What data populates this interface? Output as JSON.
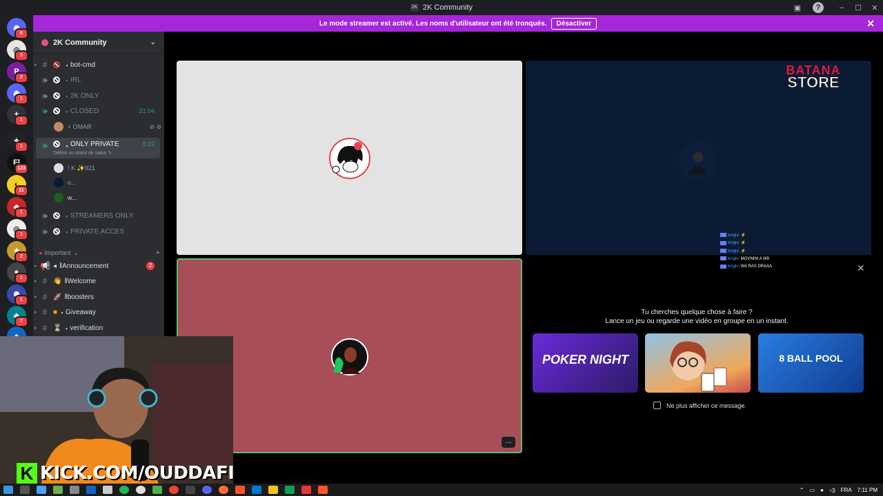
{
  "window": {
    "title": "2K Community",
    "title_icon": "2K",
    "min": "–",
    "max": "☐",
    "close": "✕",
    "help": "?",
    "inbox_icon": "▣"
  },
  "banner": {
    "text": "Le mode streamer est activé. Les noms d'utilisateur ont été tronqués.",
    "button": "Désactiver",
    "close": "✕"
  },
  "rail": {
    "servers": [
      {
        "icon": "discord-icon",
        "color": "#5865f2",
        "badge": "6",
        "glyph": "◉"
      },
      {
        "icon": "server-icon",
        "color": "#e6e6e6",
        "badge": "3",
        "glyph": "◎"
      },
      {
        "icon": "server-icon",
        "color": "#7b1fa2",
        "badge": "2",
        "glyph": "P"
      },
      {
        "icon": "server-icon",
        "color": "#5865f2",
        "badge": "1",
        "glyph": "◉"
      },
      {
        "icon": "add-icon",
        "color": "#313338",
        "badge": "1",
        "glyph": "+"
      },
      {
        "icon": "server-icon",
        "color": "#222",
        "badge": "1",
        "glyph": "✦"
      },
      {
        "icon": "server-icon",
        "color": "#111",
        "badge": "123",
        "glyph": "Fl"
      },
      {
        "icon": "server-icon",
        "color": "#f5d020",
        "badge": "11",
        "glyph": "◐"
      },
      {
        "icon": "server-icon",
        "color": "#c62828",
        "badge": "1",
        "glyph": "◆"
      },
      {
        "icon": "server-icon",
        "color": "#eee",
        "badge": "1",
        "glyph": "◎"
      },
      {
        "icon": "server-icon",
        "color": "#c49a2c",
        "badge": "2",
        "glyph": "⚜"
      },
      {
        "icon": "server-icon",
        "color": "#444",
        "badge": "1",
        "glyph": "●"
      },
      {
        "icon": "server-icon",
        "color": "#3949ab",
        "badge": "1",
        "glyph": "✺"
      },
      {
        "icon": "server-icon",
        "color": "#00838f",
        "badge": "7",
        "glyph": "◈"
      },
      {
        "icon": "server-icon",
        "color": "#1565c0",
        "badge": "",
        "glyph": "●"
      }
    ]
  },
  "sidebar": {
    "server_name": "2K Community",
    "channels": [
      {
        "label": "bot-cmd",
        "prefix": "・",
        "type": "text",
        "icon": "no-entry-icon",
        "time": "",
        "bright": true
      },
      {
        "label": "IRL",
        "prefix": "・",
        "type": "voice",
        "icon": "no-entry-icon",
        "time": "",
        "bright": false
      },
      {
        "label": "2K ONLY",
        "prefix": "・",
        "type": "voice",
        "icon": "no-entry-icon",
        "time": "",
        "bright": false
      },
      {
        "label": "CLOSED",
        "prefix": "・",
        "type": "voice",
        "icon": "no-entry-icon",
        "time": "21:04",
        "bright": false
      }
    ],
    "closed_user": "⩡ OMAR",
    "selected": {
      "label": "ONLY PRIVATE",
      "prefix": "・",
      "time": "9:22",
      "status": "Définir un statut de salon ✎"
    },
    "private_users": [
      {
        "name": "! K  ✨921",
        "color": "#ddd"
      },
      {
        "name": "o...",
        "color": "#0b1b33"
      },
      {
        "name": "w...",
        "color": "#1b5e20"
      }
    ],
    "more_channels": [
      {
        "label": "STREAMERS ONLY",
        "prefix": "・"
      },
      {
        "label": "PRIVATE ACCES",
        "prefix": "・"
      }
    ],
    "category": "Important",
    "important": [
      {
        "label": "Announcement",
        "prefix": "ǁ",
        "mention": "2"
      },
      {
        "label": "Welcome",
        "prefix": "ǁ",
        "mention": ""
      },
      {
        "label": "boosters",
        "prefix": "ǁ",
        "mention": ""
      },
      {
        "label": "Giveaway",
        "prefix": "・",
        "mention": ""
      },
      {
        "label": "verification",
        "prefix": "・",
        "mention": ""
      }
    ]
  },
  "tiles": {
    "store_logo": {
      "line1": "BATANA",
      "line2": "STORE"
    },
    "chat": [
      {
        "name": "kinglv",
        "msg": ": ⚡"
      },
      {
        "name": "kinglv",
        "msg": ": ⚡"
      },
      {
        "name": "kinglv",
        "msg": ": ⚡"
      },
      {
        "name": "kinglv",
        "msg": ": MOVNINI A W9"
      },
      {
        "name": "kinglv",
        "msg": ": WA RAS DRAAA"
      }
    ],
    "more": "···"
  },
  "activities": {
    "title_line1": "Tu cherches quelque chose à faire ?",
    "title_line2": "Lance un jeu ou regarde une vidéo en groupe en un instant.",
    "games": [
      {
        "label": "POKER NIGHT",
        "color1": "#6a2bd9",
        "color2": "#2d1b69"
      },
      {
        "label": "",
        "color1": "#f0a85a",
        "color2": "#8ec3e8"
      },
      {
        "label": "8 BALL POOL",
        "color1": "#2a7de1",
        "color2": "#0f3d91"
      }
    ],
    "checkbox_label": "Ne plus afficher ce message.",
    "close": "✕"
  },
  "overlay": {
    "kick_k": "K",
    "kick_text": "KICK.COM/OUDDAFI"
  },
  "taskbar": {
    "lang": "FRA",
    "time": "7:11 PM"
  }
}
